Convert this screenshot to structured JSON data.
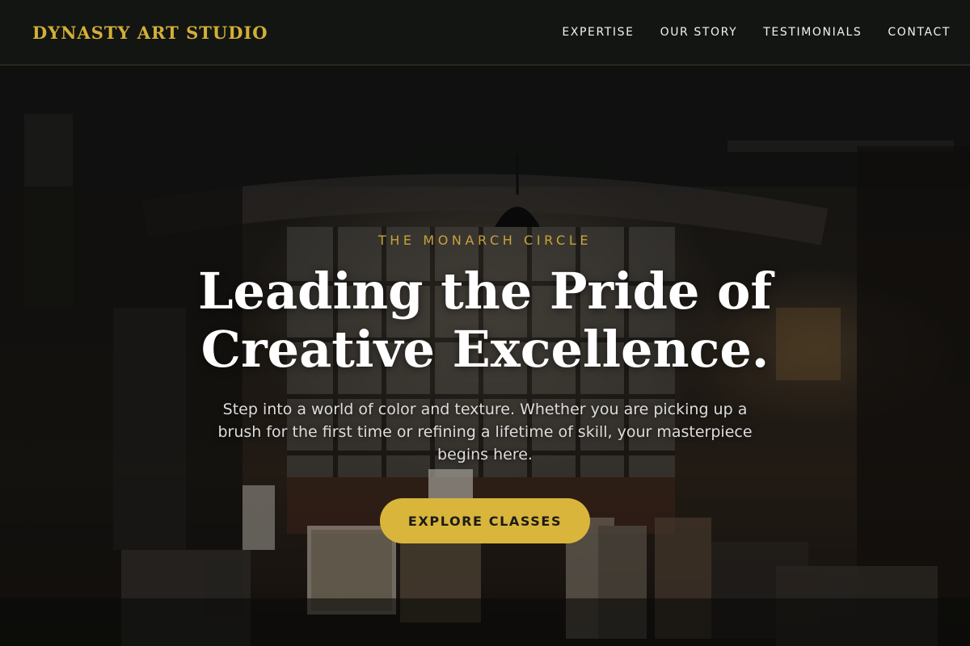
{
  "header": {
    "brand": "DYNASTY ART STUDIO",
    "nav": [
      {
        "label": "EXPERTISE"
      },
      {
        "label": "OUR STORY"
      },
      {
        "label": "TESTIMONIALS"
      },
      {
        "label": "CONTACT"
      }
    ]
  },
  "hero": {
    "eyebrow": "THE MONARCH CIRCLE",
    "headline": "Leading the Pride of Creative Excellence.",
    "subtext": "Step into a world of color and texture. Whether you are picking up a brush for the first time or refining a lifetime of skill, your masterpiece begins here.",
    "cta_label": "EXPLORE CLASSES"
  },
  "colors": {
    "accent_gold": "#d4af37",
    "cta_gold": "#d9b53c",
    "nav_background": "#121512"
  }
}
